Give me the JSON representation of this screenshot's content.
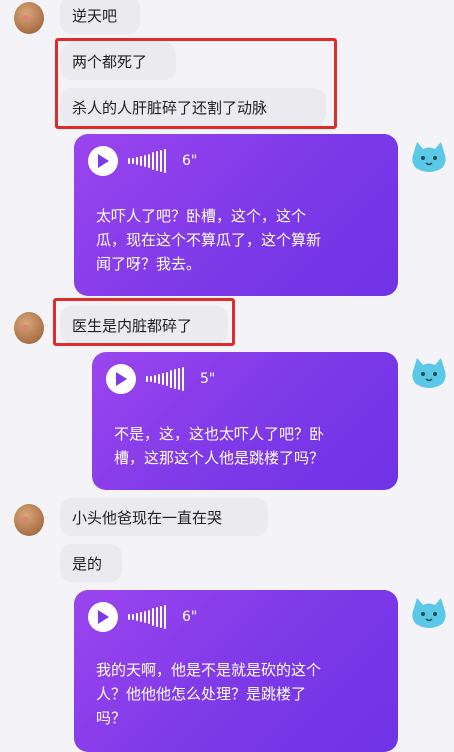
{
  "messages": {
    "m1": {
      "text": "逆天吧"
    },
    "m2": {
      "text": "两个都死了"
    },
    "m3": {
      "text": "杀人的人肝脏碎了还割了动脉"
    },
    "v1": {
      "duration": "6\"",
      "transcript": "太吓人了吧？卧槽，这个，这个\n瓜，现在这个不算瓜了，这个算新\n闻了呀？我去。"
    },
    "m4": {
      "text": "医生是内脏都碎了"
    },
    "v2": {
      "duration": "5\"",
      "transcript": "不是，这，这也太吓人了吧？卧\n槽，这那这个人他是跳楼了吗？"
    },
    "m5": {
      "text": "小头他爸现在一直在哭"
    },
    "m6": {
      "text": "是的"
    },
    "v3": {
      "duration": "6\"",
      "transcript": "我的天啊，他是不是就是砍的这个\n人？他他他怎么处理？是跳楼了\n吗？"
    }
  },
  "colors": {
    "highlight": "#e12b2b",
    "voice_card": "#7d39e8",
    "bubble": "#ebeaee"
  }
}
